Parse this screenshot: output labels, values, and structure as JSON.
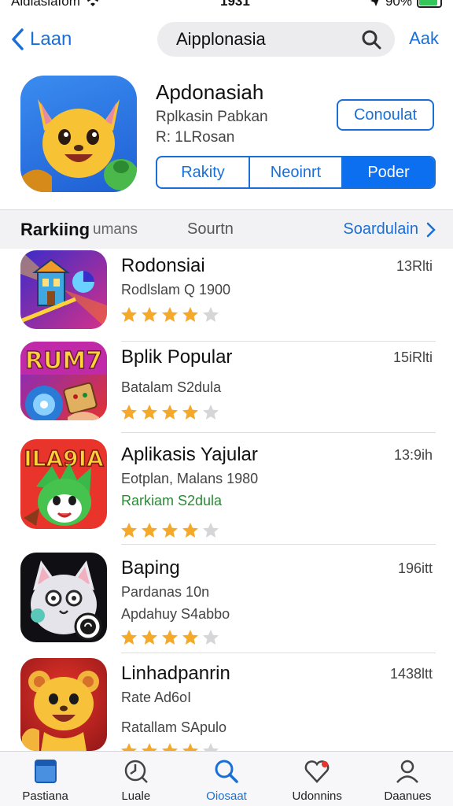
{
  "status_bar": {
    "carrier": "Aldiasiafom",
    "time": "1931",
    "battery": "90%",
    "battery_level": 0.9,
    "battery_color": "#34c759"
  },
  "nav": {
    "back_label": "Laan",
    "search_text": "Aipplonasia",
    "action_label": "Aak"
  },
  "featured": {
    "title": "Apdonasiah",
    "subtitle": "Rplkasin Pabkan",
    "meta": "R: 1LRosan",
    "cta_label": "Conoulat",
    "segments": [
      "Rakity",
      "Neoinrt",
      "Poder"
    ],
    "active_segment": 2,
    "icon": "yellow-cartoon-mascot-icon"
  },
  "section": {
    "title": "Rarkiing",
    "title_suffix": "umans",
    "middle": "Sourtn",
    "link_label": "Soardulain"
  },
  "apps": [
    {
      "name": "Rodonsiai",
      "meta1": "Rodlslam Q 1900",
      "meta2": "",
      "size": "13Rlti",
      "rating": 4,
      "icon": "building-game-icon"
    },
    {
      "name": "Bplik Popular",
      "meta1": "Batalam S2dula",
      "meta2": "",
      "size": "15iRlti",
      "rating": 4,
      "icon": "rum7-game-icon"
    },
    {
      "name": "Aplikasis Yajular",
      "meta1": "Eotplan, Malans 1980",
      "meta2": "Rarkiam S2dula",
      "size": "13:9ih",
      "rating": 4,
      "icon": "green-mascot-icon"
    },
    {
      "name": "Baping",
      "meta1": "Pardanas 10n",
      "meta2": "Apdahuy S4abbo",
      "size": "196itt",
      "rating": 4,
      "icon": "white-cat-icon"
    },
    {
      "name": "Linhadpanrin",
      "meta1": "Rate Ad6oI",
      "meta2": "Ratallam SApulo",
      "size": "1438ltt",
      "rating": 4,
      "icon": "bear-mascot-icon"
    }
  ],
  "tabs": [
    {
      "label": "Pastiana",
      "icon": "today-icon"
    },
    {
      "label": "Luale",
      "icon": "games-icon"
    },
    {
      "label": "Oiosaat",
      "icon": "search-icon"
    },
    {
      "label": "Udonnins",
      "icon": "updates-icon"
    },
    {
      "label": "Daanues",
      "icon": "account-icon"
    }
  ],
  "active_tab": 2,
  "colors": {
    "accent": "#1a6fd6",
    "star": "#f4a92a",
    "star_empty": "#d6d6d9"
  }
}
